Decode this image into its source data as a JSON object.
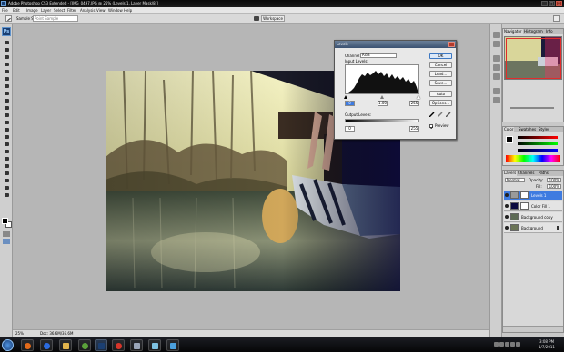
{
  "titlebar": {
    "title": "Adobe Photoshop CS3 Extended - [IMG_0497.JPG @ 25% (Levels 1, Layer Mask/8)]"
  },
  "menu": [
    "File",
    "Edit",
    "Image",
    "Layer",
    "Select",
    "Filter",
    "Analysis",
    "View",
    "Window",
    "Help"
  ],
  "options": {
    "sample_label": "Sample Size:",
    "sample_value": "Point Sample",
    "workspace": "Workspace"
  },
  "levels": {
    "title": "Levels",
    "channel_label": "Channel:",
    "channel_value": "RGB",
    "input_label": "Input Levels:",
    "input_black": "0",
    "input_gamma": "1.00",
    "input_white": "255",
    "output_label": "Output Levels:",
    "output_black": "0",
    "output_white": "255",
    "buttons": {
      "ok": "OK",
      "cancel": "Cancel",
      "load": "Load...",
      "save": "Save...",
      "auto": "Auto",
      "options": "Options..."
    },
    "preview_label": "Preview",
    "preview_checked": true
  },
  "panels": {
    "navigator_tabs": [
      "Navigator",
      "Histogram",
      "Info"
    ],
    "color_tabs": [
      "Color",
      "Swatches",
      "Styles"
    ],
    "layers_tabs": [
      "Layers",
      "Channels",
      "Paths"
    ],
    "blend_mode": "Normal",
    "opacity_label": "Opacity:",
    "opacity_value": "100%",
    "fill_label": "Fill:",
    "fill_value": "100%",
    "layers": [
      {
        "name": "Levels 1",
        "selected": true
      },
      {
        "name": "Color Fill 1",
        "selected": false
      },
      {
        "name": "Background copy",
        "selected": false
      },
      {
        "name": "Background",
        "selected": false
      }
    ]
  },
  "status": {
    "zoom": "25%",
    "doc": "Doc: 36.6M/36.6M"
  },
  "taskbar": {
    "time": "3:08 PM",
    "date": "1/7/2011"
  },
  "colors": {
    "accent": "#3e7be0",
    "titlebar": "#0a0a0a",
    "canvas_bg": "#b6b6b6"
  }
}
